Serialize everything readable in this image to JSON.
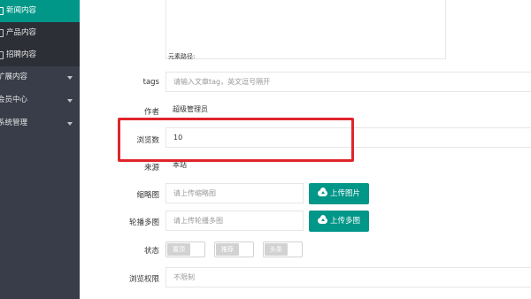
{
  "sidebar": {
    "items": [
      {
        "label": "新闻内容",
        "state": "active"
      },
      {
        "label": "产品内容",
        "state": "sub"
      },
      {
        "label": "招聘内容",
        "state": "sub"
      },
      {
        "label": "扩展内容",
        "state": "group"
      },
      {
        "label": "会员中心",
        "state": "group"
      },
      {
        "label": "系统管理",
        "state": "group"
      }
    ]
  },
  "editor": {
    "path_label": "元素路径:"
  },
  "form": {
    "tags": {
      "label": "tags",
      "placeholder": "请输入文章tag，英文逗号隔开"
    },
    "author": {
      "label": "作者",
      "value": "超级管理员"
    },
    "views": {
      "label": "浏览数",
      "value": "10"
    },
    "source": {
      "label": "来源",
      "value": "本站"
    },
    "thumbnail": {
      "label": "缩略图",
      "placeholder": "请上传缩略图",
      "button": "上传图片"
    },
    "carousel": {
      "label": "轮播多图",
      "placeholder": "请上传轮播多图",
      "button": "上传多图"
    },
    "status": {
      "label": "状态",
      "switches": [
        "置顶",
        "推荐",
        "头条"
      ]
    },
    "permission": {
      "label": "浏览权限",
      "value": "不限制"
    }
  },
  "colors": {
    "accent": "#009688",
    "sidebar": "#393d49",
    "highlight": "#e0242b"
  }
}
